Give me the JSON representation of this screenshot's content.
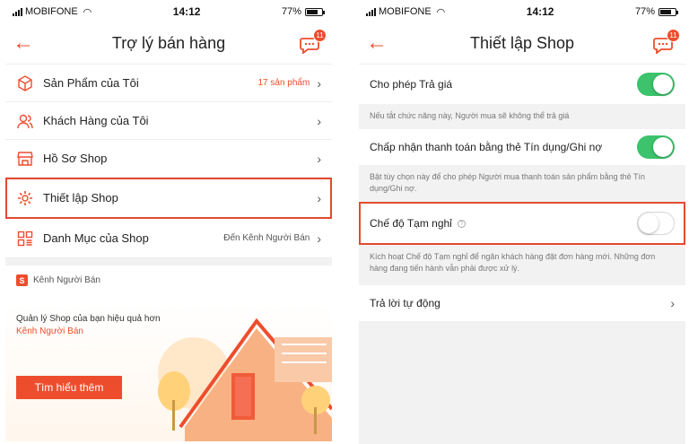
{
  "status": {
    "carrier": "MOBIFONE",
    "time": "14:12",
    "battery": "77%",
    "battery_level": 0.77
  },
  "left": {
    "title": "Trợ lý bán hàng",
    "chat_badge": "11",
    "menu": [
      {
        "label": "Sản Phẩm của Tôi",
        "meta": "17 sản phẩm",
        "icon": "box-icon"
      },
      {
        "label": "Khách Hàng của Tôi",
        "meta": "",
        "icon": "users-icon"
      },
      {
        "label": "Hồ Sơ Shop",
        "meta": "",
        "icon": "shop-icon"
      },
      {
        "label": "Thiết lập Shop",
        "meta": "",
        "icon": "gear-icon"
      },
      {
        "label": "Danh Mục của Shop",
        "meta": "Đến Kênh Người Bán",
        "icon": "category-icon"
      }
    ],
    "seller_channel": {
      "header": "Kênh Người Bán",
      "tagline": "Quản lý Shop của bạn hiệu quả hơn",
      "link": "Kênh Người Bán",
      "button": "Tìm hiểu thêm"
    }
  },
  "right": {
    "title": "Thiết lập Shop",
    "chat_badge": "11",
    "settings": [
      {
        "label": "Cho phép Trả giá",
        "on": true,
        "description": "Nếu tắt chức năng này, Người mua sẽ không thể trả giá"
      },
      {
        "label": "Chấp nhận thanh toán bằng thẻ Tín dụng/Ghi nợ",
        "on": true,
        "description": "Bật tùy chọn này để cho phép Người mua thanh toán sản phẩm bằng thẻ Tín dụng/Ghi nợ."
      },
      {
        "label": "Chế độ Tạm nghỉ",
        "on": false,
        "description": "Kích hoạt Chế độ Tạm nghỉ để ngăn khách hàng đặt đơn hàng mới. Những đơn hàng đang tiến hành vẫn phải được xử lý."
      }
    ],
    "auto_reply": "Trả lời tự động"
  },
  "colors": {
    "accent": "#ee4d2d",
    "toggle_on": "#3cc36c",
    "highlight": "#e14b2f"
  }
}
